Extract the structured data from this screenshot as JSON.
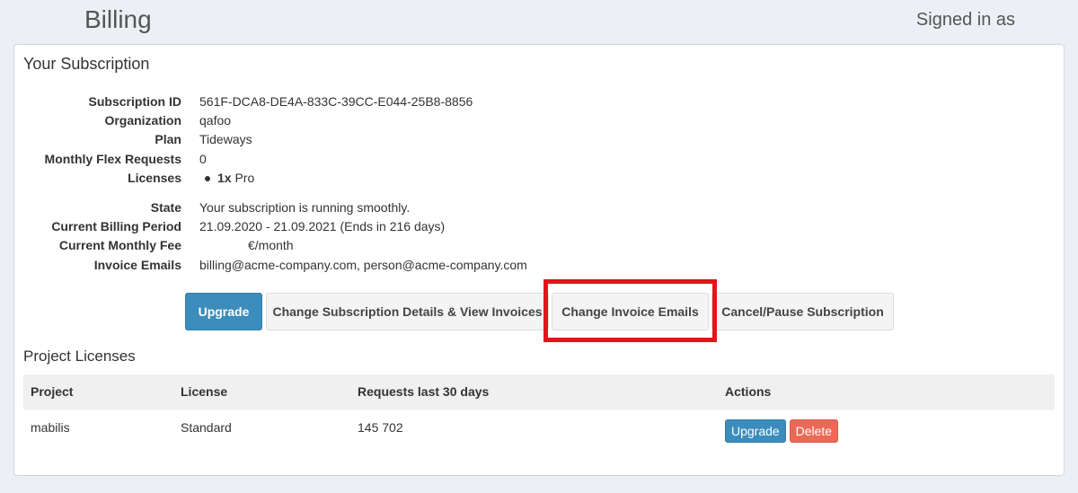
{
  "header": {
    "title": "Billing",
    "signed_in": "Signed in as"
  },
  "subscription": {
    "title": "Your Subscription",
    "fields": [
      {
        "label": "Subscription ID",
        "value": "561F-DCA8-DE4A-833C-39CC-E044-25B8-8856"
      },
      {
        "label": "Organization",
        "value": "qafoo"
      },
      {
        "label": "Plan",
        "value": "Tideways"
      },
      {
        "label": "Monthly Flex Requests",
        "value": "0"
      },
      {
        "label": "Licenses",
        "value_count": "1x",
        "value_type": "Pro"
      }
    ],
    "fields2": [
      {
        "label": "State",
        "value": "Your subscription is running smoothly."
      },
      {
        "label": "Current Billing Period",
        "value": "21.09.2020 - 21.09.2021 (Ends in 216 days)"
      },
      {
        "label": "Current Monthly Fee",
        "value": "€/month"
      },
      {
        "label": "Invoice Emails",
        "value": "billing@acme-company.com, person@acme-company.com"
      }
    ],
    "buttons": {
      "upgrade": "Upgrade",
      "change_details": "Change Subscription Details & View Invoices",
      "change_emails": "Change Invoice Emails",
      "cancel": "Cancel/Pause Subscription"
    }
  },
  "licenses": {
    "title": "Project Licenses",
    "columns": [
      "Project",
      "License",
      "Requests last 30 days",
      "Actions"
    ],
    "rows": [
      {
        "project": "mabilis",
        "license": "Standard",
        "requests": "145 702",
        "upgrade": "Upgrade",
        "delete": "Delete"
      }
    ]
  },
  "colors": {
    "primary": "#3c8dbc",
    "danger": "#ea6a58",
    "highlight": "#e3151a"
  }
}
